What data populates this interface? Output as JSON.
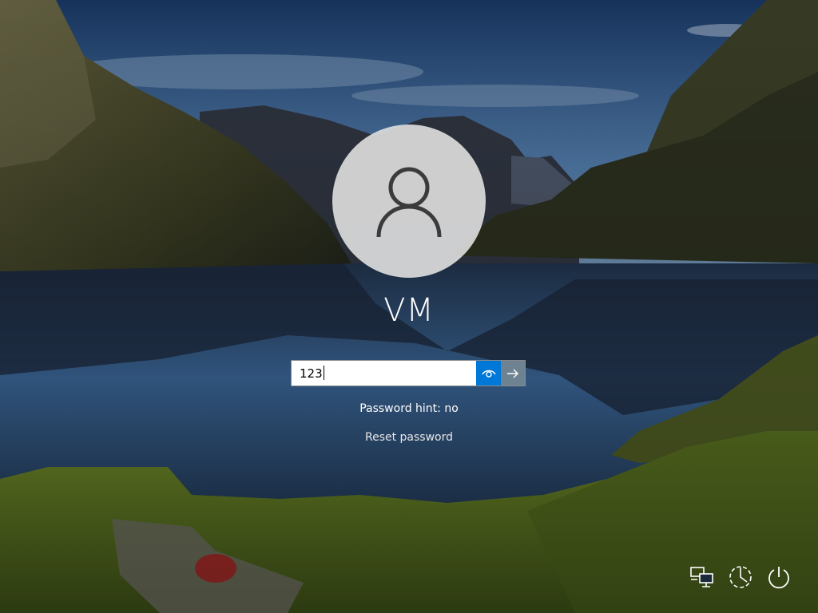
{
  "background": {
    "sky_top": "#1c3c68",
    "water": "#3f6d9e",
    "grass": "#5f7a20"
  },
  "user": {
    "name": "VM",
    "avatar_icon": "user-silhouette-icon"
  },
  "password_field": {
    "value": "123",
    "reveal_icon": "eye-icon",
    "submit_icon": "arrow-right-icon"
  },
  "hint_text": "Password hint: no",
  "reset_link": "Reset password",
  "bottom_icons": [
    "network-icon",
    "accessibility-icon",
    "power-icon"
  ],
  "colors": {
    "accent": "#0078d7",
    "text": "#ffffff"
  }
}
